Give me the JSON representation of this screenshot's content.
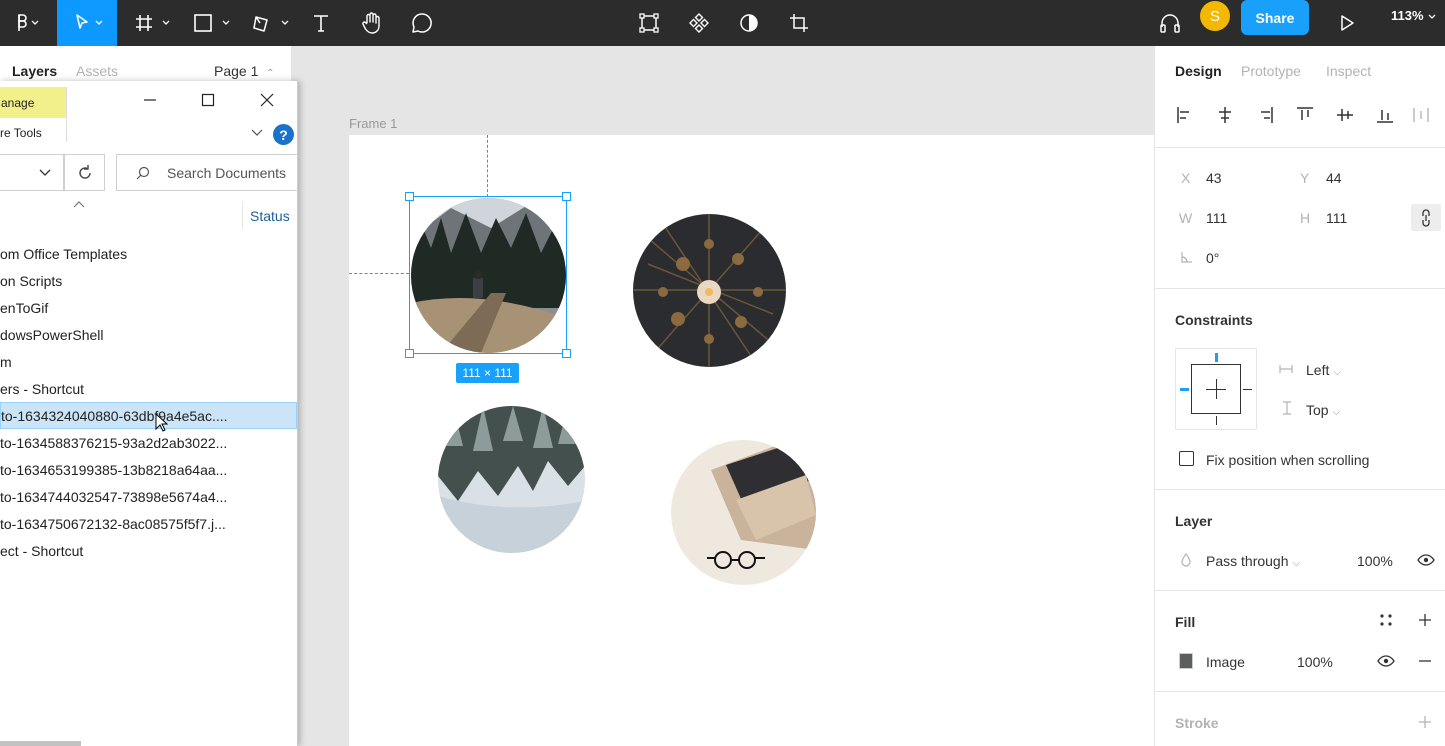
{
  "toolbar": {
    "tools": [
      "figma-menu",
      "move-tool",
      "frame-tool",
      "shape-tool",
      "pen-tool",
      "text-tool",
      "hand-tool",
      "comment-tool"
    ],
    "center_tools": [
      "component-icon",
      "instance-icon",
      "contrast-icon",
      "crop-icon"
    ],
    "avatar_initial": "S",
    "share_label": "Share",
    "zoom_label": "113%"
  },
  "layers_panel": {
    "tab_layers": "Layers",
    "tab_assets": "Assets",
    "page_label": "Page 1"
  },
  "explorer": {
    "ribbon_manage": "anage",
    "ribbon_tools": "re Tools",
    "search_placeholder": "Search Documents",
    "status_header": "Status",
    "files": [
      "om Office Templates",
      "on Scripts",
      "enToGif",
      "dowsPowerShell",
      "m",
      "ers - Shortcut",
      "to-1634324040880-63dbf9a4e5ac....",
      "to-1634588376215-93a2d2ab3022...",
      "to-1634653199385-13b8218a64aa...",
      "to-1634744032547-73898e5674a4...",
      "to-1634750672132-8ac08575f5f7.j...",
      "ect - Shortcut"
    ],
    "selected_index": 6
  },
  "canvas": {
    "frame_label": "Frame 1",
    "selection_size": "111 × 111"
  },
  "design_panel": {
    "tabs": [
      "Design",
      "Prototype",
      "Inspect"
    ],
    "x_label": "X",
    "x_value": "43",
    "y_label": "Y",
    "y_value": "44",
    "w_label": "W",
    "w_value": "111",
    "h_label": "H",
    "h_value": "111",
    "rotation_value": "0°",
    "constraints_title": "Constraints",
    "constraint_horizontal": "Left",
    "constraint_vertical": "Top",
    "fix_position_label": "Fix position when scrolling",
    "layer_title": "Layer",
    "blend_mode": "Pass through",
    "layer_opacity": "100%",
    "fill_title": "Fill",
    "fill_type": "Image",
    "fill_opacity": "100%",
    "stroke_title": "Stroke"
  },
  "colors": {
    "accent": "#18a0fb",
    "toolbar_bg": "#2c2c2c",
    "avatar": "#f5b800"
  }
}
